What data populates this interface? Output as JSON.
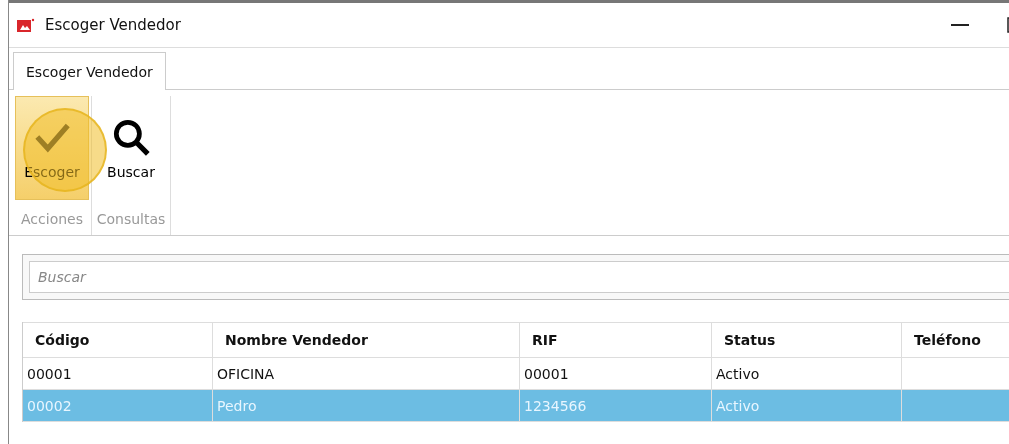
{
  "window": {
    "title": "Escoger Vendedor"
  },
  "tabs": [
    {
      "label": "Escoger Vendedor",
      "selected": true
    }
  ],
  "ribbon_groups": [
    {
      "label": "Acciones",
      "buttons": [
        {
          "label": "Escoger",
          "kind": "check",
          "selected": true
        }
      ]
    },
    {
      "label": "Consultas",
      "buttons": [
        {
          "label": "Buscar",
          "kind": "search",
          "selected": false
        }
      ]
    }
  ],
  "search": {
    "placeholder": "Buscar"
  },
  "table": {
    "columns": [
      "Código",
      "Nombre Vendedor",
      "RIF",
      "Status",
      "Teléfono"
    ],
    "rows": [
      {
        "cells": [
          "00001",
          "OFICINA",
          "00001",
          "Activo",
          ""
        ],
        "selected": false
      },
      {
        "cells": [
          "00002",
          "Pedro",
          "1234566",
          "Activo",
          ""
        ],
        "selected": true
      }
    ]
  }
}
